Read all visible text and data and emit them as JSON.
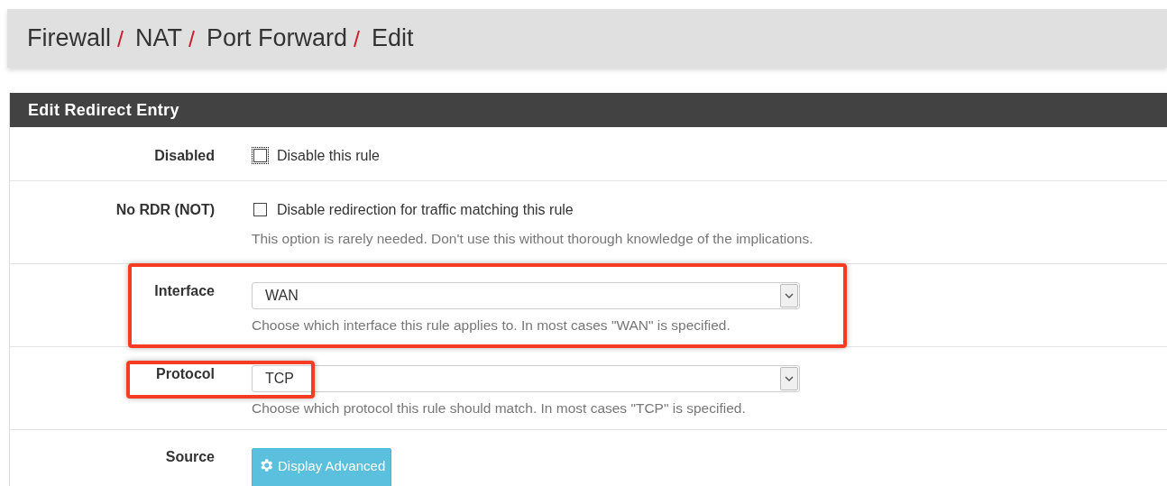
{
  "breadcrumb": [
    "Firewall",
    "NAT",
    "Port Forward",
    "Edit"
  ],
  "panel": {
    "title": "Edit Redirect Entry",
    "rows": [
      {
        "kind": "checkbox",
        "label": "Disabled",
        "text": "Disable this rule",
        "checked": false,
        "focused": true
      },
      {
        "kind": "checkbox",
        "label": "No RDR (NOT)",
        "text": "Disable redirection for traffic matching this rule",
        "checked": false,
        "focused": false,
        "help": "This option is rarely needed. Don't use this without thorough knowledge of the implications."
      },
      {
        "kind": "select",
        "label": "Interface",
        "value": "WAN",
        "help": "Choose which interface this rule applies to. In most cases \"WAN\" is specified.",
        "highlighted": true,
        "help_highlighted": true
      },
      {
        "kind": "select",
        "label": "Protocol",
        "value": "TCP",
        "help": "Choose which protocol this rule should match. In most cases \"TCP\" is specified.",
        "highlighted": true,
        "help_highlighted": false
      },
      {
        "kind": "button",
        "label": "Source",
        "text": "Display Advanced"
      }
    ]
  }
}
